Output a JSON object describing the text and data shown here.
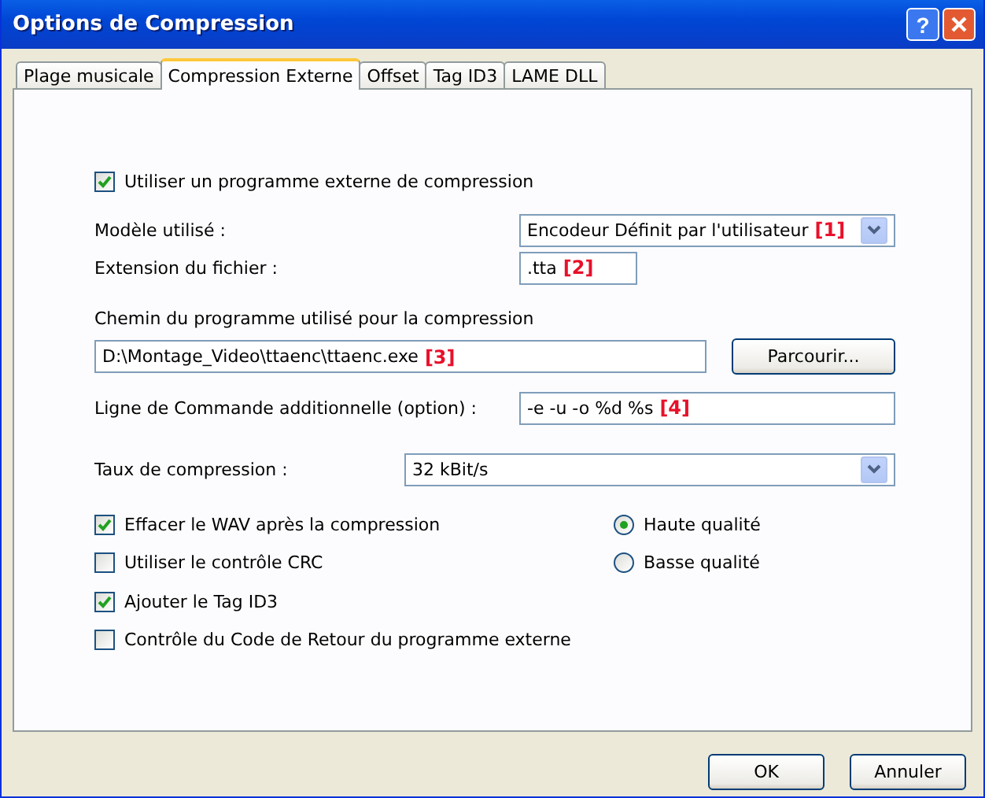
{
  "window": {
    "title": "Options de Compression",
    "help_button": "?"
  },
  "tabs": [
    {
      "label": "Plage musicale",
      "selected": false
    },
    {
      "label": "Compression Externe",
      "selected": true
    },
    {
      "label": "Offset",
      "selected": false
    },
    {
      "label": "Tag ID3",
      "selected": false
    },
    {
      "label": "LAME DLL",
      "selected": false
    }
  ],
  "use_external": {
    "label": "Utiliser un programme externe de compression",
    "checked": true
  },
  "model": {
    "label": "Modèle utilisé :",
    "value": "Encodeur Définit par l'utilisateur",
    "note": "[1]"
  },
  "extension": {
    "label": "Extension du fichier :",
    "value": ".tta",
    "note": "[2]"
  },
  "path": {
    "label": "Chemin du programme utilisé pour la compression",
    "value": "D:\\Montage_Video\\ttaenc\\ttaenc.exe",
    "note": "[3]",
    "browse": "Parcourir..."
  },
  "command": {
    "label": "Ligne de Commande additionnelle (option) :",
    "value": "-e -u -o %d %s",
    "note": "[4]"
  },
  "rate": {
    "label": "Taux de compression :",
    "value": "32 kBit/s"
  },
  "options": [
    {
      "label": "Effacer le WAV après la compression",
      "checked": true
    },
    {
      "label": "Utiliser le contrôle CRC",
      "checked": false
    },
    {
      "label": "Ajouter le Tag ID3",
      "checked": true
    },
    {
      "label": "Contrôle du Code de Retour du programme externe",
      "checked": false
    }
  ],
  "quality": [
    {
      "label": "Haute qualité",
      "selected": true
    },
    {
      "label": "Basse qualité",
      "selected": false
    }
  ],
  "buttons": [
    "OK",
    "Annuler"
  ]
}
